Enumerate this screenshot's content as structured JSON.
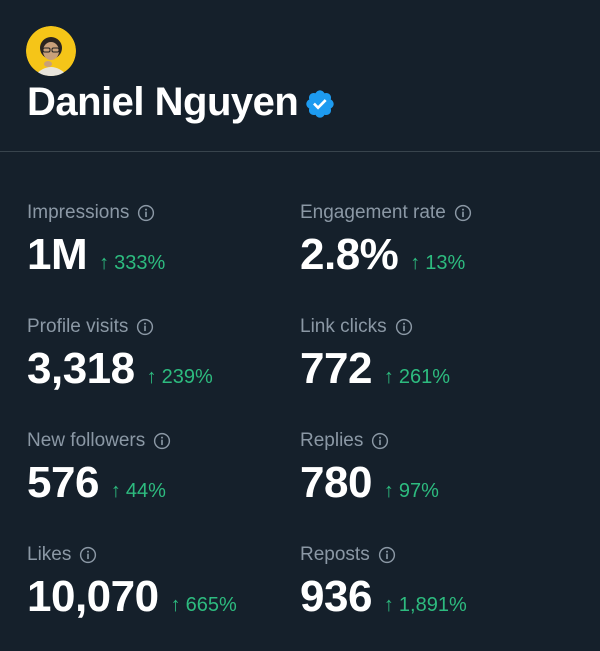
{
  "profile": {
    "name": "Daniel Nguyen",
    "verified": true,
    "accent_verified": "#1d9bf0",
    "avatar_bg": "#f5c518"
  },
  "colors": {
    "background": "#15202b",
    "label": "#8b98a5",
    "positive": "#2dbb7f",
    "divider": "#38444d"
  },
  "metrics": [
    {
      "label": "Impressions",
      "value": "1M",
      "change": "333%"
    },
    {
      "label": "Engagement rate",
      "value": "2.8%",
      "change": "13%"
    },
    {
      "label": "Profile visits",
      "value": "3,318",
      "change": "239%"
    },
    {
      "label": "Link clicks",
      "value": "772",
      "change": "261%"
    },
    {
      "label": "New followers",
      "value": "576",
      "change": "44%"
    },
    {
      "label": "Replies",
      "value": "780",
      "change": "97%"
    },
    {
      "label": "Likes",
      "value": "10,070",
      "change": "665%"
    },
    {
      "label": "Reposts",
      "value": "936",
      "change": "1,891%"
    }
  ],
  "icons": {
    "info": "info-circle-icon",
    "trend": "arrow-up-icon",
    "verified": "verified-badge-icon"
  }
}
